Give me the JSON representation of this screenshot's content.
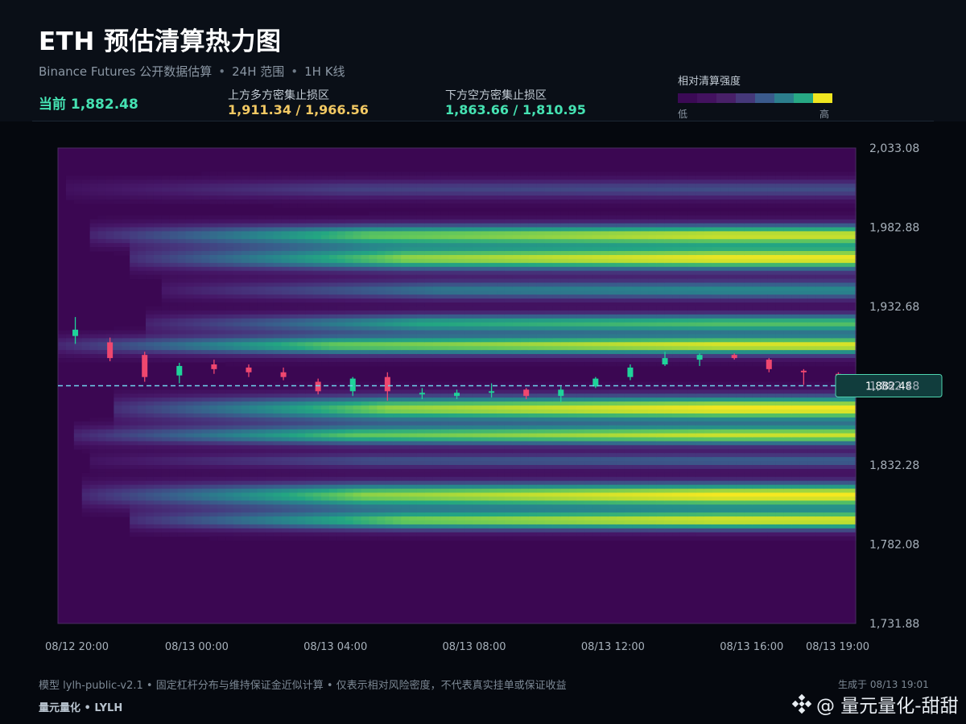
{
  "header": {
    "title": "ETH 预估清算热力图",
    "subtitle_parts": [
      "Binance Futures 公开数据估算",
      "24H 范围",
      "1H K线"
    ],
    "subtitle_sep": "•",
    "current_text": "当前 1,882.48",
    "upper_zone": {
      "label": "上方多方密集止损区",
      "value": "1,911.34 / 1,966.56"
    },
    "lower_zone": {
      "label": "下方空方密集止损区",
      "value": "1,863.66 / 1,810.95"
    }
  },
  "legend": {
    "title": "相对清算强度",
    "low": "低",
    "high": "高",
    "colors": [
      "#3b0a55",
      "#43125f",
      "#482068",
      "#453879",
      "#3a5a8c",
      "#2c7e8d",
      "#27a884",
      "#f0e620"
    ]
  },
  "chart_data": {
    "type": "heatmap",
    "y_axis": {
      "min": 1731.88,
      "max": 2033.08,
      "ticks": [
        2033.08,
        1982.88,
        1932.68,
        1882.48,
        1832.28,
        1782.08,
        1731.88
      ],
      "tick_labels": [
        "2,033.08",
        "1,982.88",
        "1,932.68",
        "1,882.48",
        "1,832.28",
        "1,782.08",
        "1,731.88"
      ]
    },
    "x_axis": {
      "tick_labels": [
        "08/12 20:00",
        "08/13 00:00",
        "08/13 04:00",
        "08/13 08:00",
        "08/13 12:00",
        "08/13 16:00",
        "08/13 19:00"
      ],
      "tick_hours": [
        0,
        4,
        8,
        12,
        16,
        20,
        23
      ]
    },
    "current_price": 1882.48,
    "current_price_label": "1,882.48",
    "bands": [
      {
        "center": 2007,
        "width": 4.5,
        "peak": 0.38,
        "start_hour": 0.3
      },
      {
        "center": 1978,
        "width": 5,
        "peak": 0.92,
        "start_hour": 1.0
      },
      {
        "center": 1963,
        "width": 5.5,
        "peak": 0.98,
        "start_hour": 2.0
      },
      {
        "center": 1943,
        "width": 4.5,
        "peak": 0.6,
        "start_hour": 3.0
      },
      {
        "center": 1922,
        "width": 4.5,
        "peak": 0.78,
        "start_hour": 2.5
      },
      {
        "center": 1908,
        "width": 4.5,
        "peak": 0.96,
        "start_hour": 0.0
      },
      {
        "center": 1868,
        "width": 6,
        "peak": 1.0,
        "start_hour": 1.5
      },
      {
        "center": 1851,
        "width": 4.5,
        "peak": 0.92,
        "start_hour": 0.5
      },
      {
        "center": 1835,
        "width": 3.5,
        "peak": 0.45,
        "start_hour": 1.0
      },
      {
        "center": 1813,
        "width": 6,
        "peak": 1.0,
        "start_hour": 0.8
      },
      {
        "center": 1797,
        "width": 4.5,
        "peak": 0.93,
        "start_hour": 2.0
      }
    ],
    "candles": [
      {
        "hour": 0.5,
        "open": 1914,
        "close": 1918,
        "high": 1926,
        "low": 1909
      },
      {
        "hour": 1.5,
        "open": 1910,
        "close": 1900,
        "high": 1913,
        "low": 1898
      },
      {
        "hour": 2.5,
        "open": 1902,
        "close": 1888,
        "high": 1904,
        "low": 1885
      },
      {
        "hour": 3.5,
        "open": 1889,
        "close": 1895,
        "high": 1897,
        "low": 1884
      },
      {
        "hour": 4.5,
        "open": 1896,
        "close": 1893,
        "high": 1899,
        "low": 1890
      },
      {
        "hour": 5.5,
        "open": 1894,
        "close": 1891,
        "high": 1896,
        "low": 1888
      },
      {
        "hour": 6.5,
        "open": 1891,
        "close": 1888,
        "high": 1894,
        "low": 1886
      },
      {
        "hour": 7.5,
        "open": 1885,
        "close": 1879,
        "high": 1887,
        "low": 1877
      },
      {
        "hour": 8.5,
        "open": 1879,
        "close": 1887,
        "high": 1888,
        "low": 1876
      },
      {
        "hour": 9.5,
        "open": 1888,
        "close": 1879,
        "high": 1891,
        "low": 1873
      },
      {
        "hour": 10.5,
        "open": 1877,
        "close": 1878,
        "high": 1881,
        "low": 1874
      },
      {
        "hour": 11.5,
        "open": 1876,
        "close": 1878,
        "high": 1880,
        "low": 1874
      },
      {
        "hour": 12.5,
        "open": 1878,
        "close": 1879,
        "high": 1884,
        "low": 1875
      },
      {
        "hour": 13.5,
        "open": 1880,
        "close": 1876,
        "high": 1881,
        "low": 1874
      },
      {
        "hour": 14.5,
        "open": 1876,
        "close": 1880,
        "high": 1882,
        "low": 1872
      },
      {
        "hour": 15.5,
        "open": 1882,
        "close": 1887,
        "high": 1888,
        "low": 1881
      },
      {
        "hour": 16.5,
        "open": 1888,
        "close": 1894,
        "high": 1896,
        "low": 1886
      },
      {
        "hour": 17.5,
        "open": 1896,
        "close": 1900,
        "high": 1904,
        "low": 1895
      },
      {
        "hour": 18.5,
        "open": 1899,
        "close": 1902,
        "high": 1903,
        "low": 1895
      },
      {
        "hour": 19.5,
        "open": 1902,
        "close": 1900,
        "high": 1903,
        "low": 1899
      },
      {
        "hour": 20.5,
        "open": 1899,
        "close": 1893,
        "high": 1900,
        "low": 1891
      },
      {
        "hour": 21.5,
        "open": 1892,
        "close": 1891,
        "high": 1893,
        "low": 1883
      },
      {
        "hour": 22.5,
        "open": 1890,
        "close": 1884,
        "high": 1891,
        "low": 1883
      }
    ],
    "colors": {
      "up": "#1fd39a",
      "down": "#ef476f",
      "price_line": "#6fd3ee",
      "badge_fill": "#113d3d",
      "badge_stroke": "#4fd6b0"
    }
  },
  "footer": {
    "note": "模型 lylh-public-v2.1 • 固定杠杆分布与维持保证金近似计算 • 仅表示相对风险密度，不代表真实挂单或保证收益",
    "brand": "量元量化 • LYLH",
    "generated": "生成于 08/13 19:01",
    "watermark": "@ 量元量化-甜甜"
  }
}
